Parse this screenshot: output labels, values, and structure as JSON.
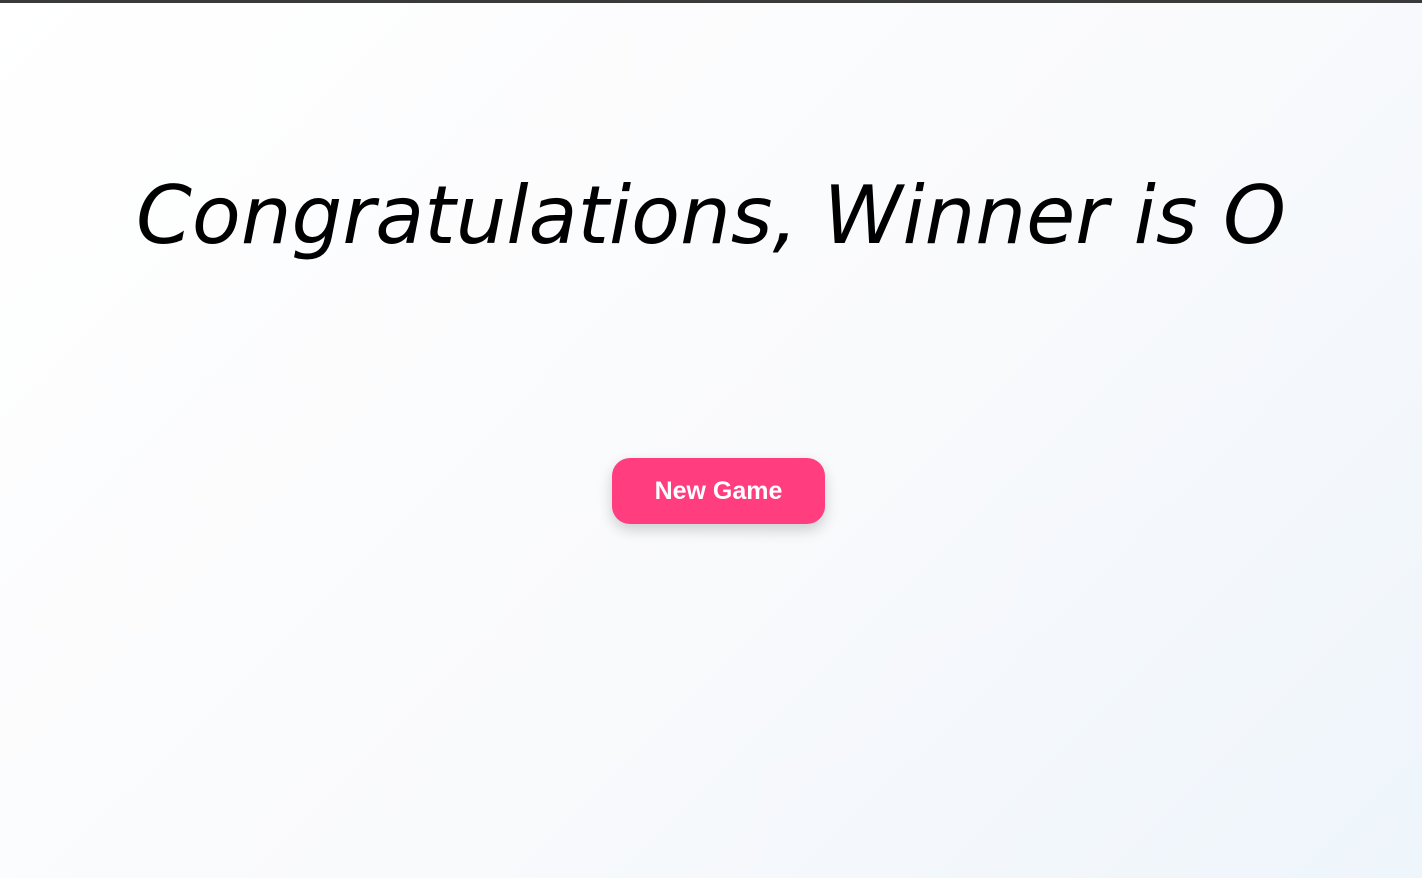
{
  "game": {
    "winner_message": "Congratulations, Winner is O",
    "new_game_label": "New Game"
  },
  "colors": {
    "button_background": "#ff3d7f",
    "button_text": "#ffffff",
    "message_text": "#000000",
    "page_background": "#f9fafc"
  }
}
